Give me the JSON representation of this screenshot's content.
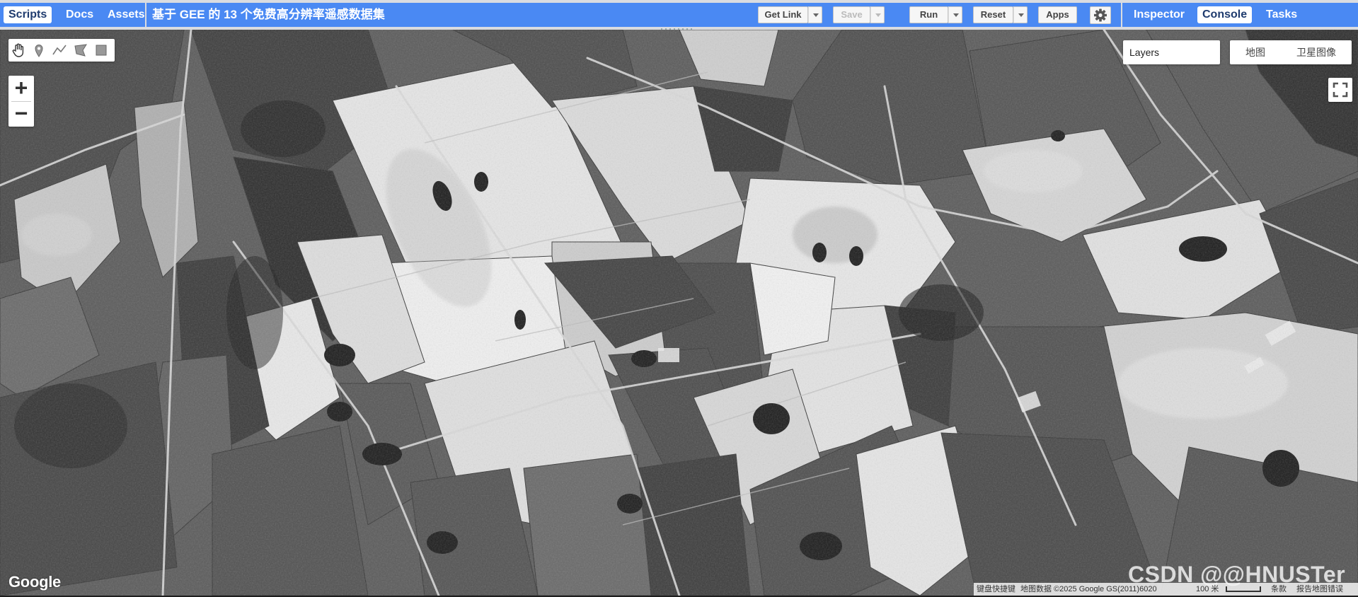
{
  "left_panel": {
    "tabs": [
      {
        "label": "Scripts",
        "active": true
      },
      {
        "label": "Docs",
        "active": false
      },
      {
        "label": "Assets",
        "active": false
      }
    ]
  },
  "toolbar": {
    "script_title": "基于 GEE 的 13 个免费高分辨率遥感数据集",
    "get_link": "Get Link",
    "save": "Save",
    "run": "Run",
    "reset": "Reset",
    "apps": "Apps",
    "settings_icon": "gear-icon"
  },
  "right_panel": {
    "tabs": [
      {
        "label": "Inspector",
        "active": false
      },
      {
        "label": "Console",
        "active": true
      },
      {
        "label": "Tasks",
        "active": false
      }
    ]
  },
  "map": {
    "drawing_tools": [
      "hand-icon",
      "point-marker-icon",
      "line-icon",
      "polygon-icon",
      "rectangle-icon"
    ],
    "zoom_in": "+",
    "zoom_out": "−",
    "layers_label": "Layers",
    "map_types": [
      "地图",
      "卫星图像"
    ],
    "fullscreen_icon": "fullscreen-icon",
    "imagery": "grayscale satellite image of agricultural fields",
    "google_logo": "Google",
    "attribution": {
      "shortcuts": "键盘快捷键",
      "data": "地图数据 ©2025 Google GS(2011)6020",
      "scale": "100 米",
      "terms": "条款",
      "report": "报告地图错误"
    },
    "watermark": "CSDN @@HNUSTer"
  },
  "colors": {
    "accent_blue": "#4a89f3",
    "topbar_gray": "#dadce0",
    "active_tab_text": "#1f3b6e"
  }
}
